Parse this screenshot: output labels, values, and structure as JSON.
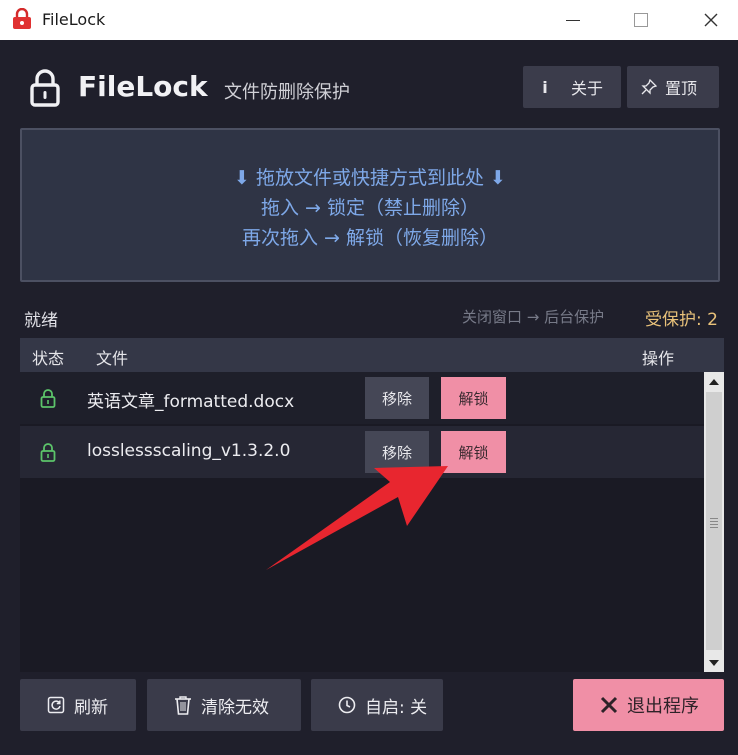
{
  "window": {
    "title": "FileLock"
  },
  "header": {
    "app_name": "FileLock",
    "subtitle": "文件防删除保护",
    "about_icon": "i",
    "about_label": "关于",
    "pin_label": "置顶"
  },
  "dropzone": {
    "line1": "⬇ 拖放文件或快捷方式到此处 ⬇",
    "line2": "拖入 → 锁定（禁止删除）",
    "line3": "再次拖入 → 解锁（恢复删除）"
  },
  "status": {
    "text": "就绪",
    "background_hint": "关闭窗口 → 后台保护",
    "protected": "受保护: 2"
  },
  "table": {
    "columns": {
      "status": "状态",
      "file": "文件",
      "actions": "操作"
    },
    "rows": [
      {
        "status_icon": "lock-icon",
        "file": "英语文章_formatted.docx",
        "remove": "移除",
        "unlock": "解锁"
      },
      {
        "status_icon": "lock-icon",
        "file": "losslessscaling_v1.3.2.0",
        "remove": "移除",
        "unlock": "解锁"
      }
    ]
  },
  "footer": {
    "refresh": "刷新",
    "clear_invalid": "清除无效",
    "autostart": "自启: 关",
    "quit": "退出程序"
  },
  "colors": {
    "background": "#1f1f2b",
    "accent_pink": "#f08fa6",
    "dropzone_text": "#7ea8e8",
    "protected_count": "#e9c27a",
    "lock_green": "#5cc46a",
    "annotation_arrow": "#e8262f"
  }
}
